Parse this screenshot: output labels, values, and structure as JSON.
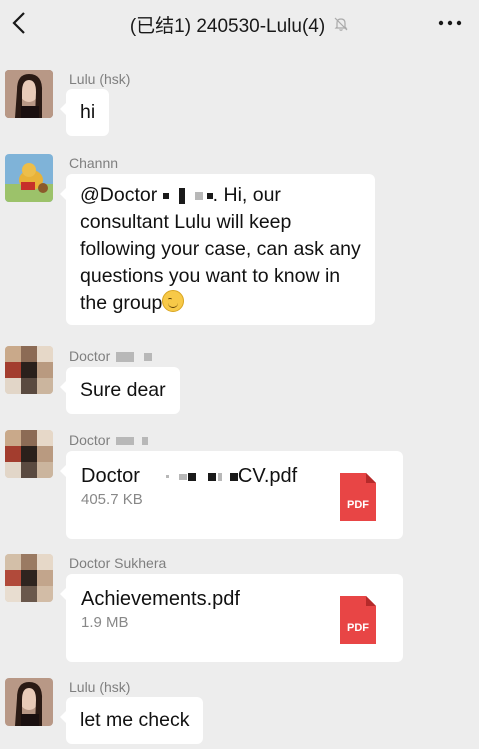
{
  "header": {
    "title": "(已结1) 240530-Lulu(4)",
    "back_icon": "chevron-left-icon",
    "mute_icon": "bell-muted-icon",
    "more_icon": "more-dots-icon"
  },
  "messages": [
    {
      "sender": "Lulu (hsk)",
      "text": "hi"
    },
    {
      "sender": "Channn",
      "text_prefix": "@Doctor ",
      "text_after_redact": ". Hi, our",
      "text_line2": "consultant Lulu will keep",
      "text_line3": "following your case, can ask any",
      "text_line4": "questions you want to know in",
      "text_line5": "the group"
    },
    {
      "sender": "Doctor",
      "text": "Sure dear"
    },
    {
      "sender": "Doctor",
      "file": {
        "name_prefix": "Doctor",
        "name_suffix": "CV.pdf",
        "size": "405.7 KB",
        "icon_label": "PDF"
      }
    },
    {
      "sender": "Doctor Sukhera",
      "file": {
        "name": "Achievements.pdf",
        "size": "1.9 MB",
        "icon_label": "PDF"
      }
    },
    {
      "sender": "Lulu (hsk)",
      "text": "let me check"
    }
  ],
  "colors": {
    "background": "#ededed",
    "bubble": "#ffffff",
    "pdf_red": "#e84545",
    "sender_gray": "#7f7f7f"
  }
}
